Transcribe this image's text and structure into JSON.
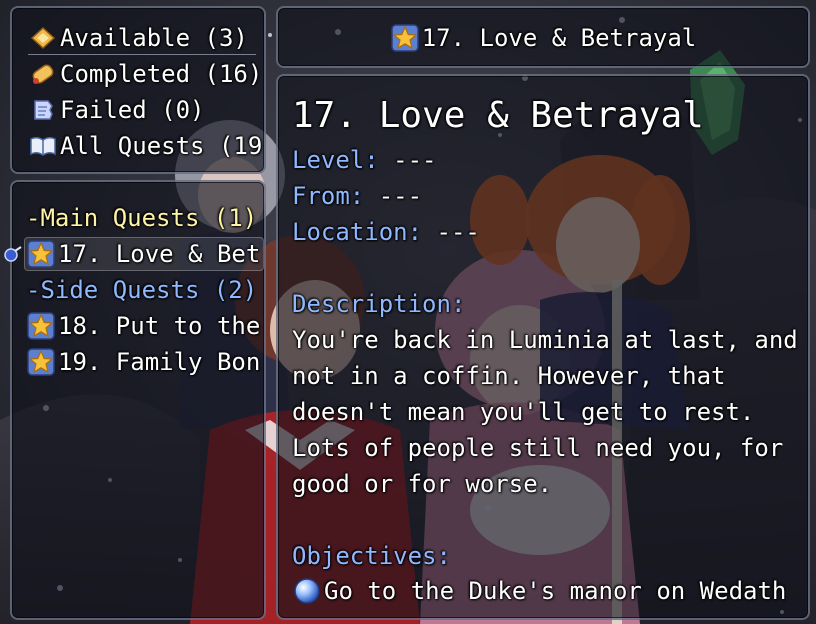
{
  "categories": [
    {
      "label": "Available (3)",
      "icon": "scroll-open-icon"
    },
    {
      "label": "Completed (16)",
      "icon": "scroll-rolled-icon"
    },
    {
      "label": "Failed (0)",
      "icon": "torn-paper-icon"
    },
    {
      "label": "All Quests (19",
      "icon": "open-book-icon"
    }
  ],
  "quest_list": {
    "main_header": "-Main Quests (1)",
    "main_items": [
      {
        "label": "17. Love & Bet",
        "icon": "star-medal-icon",
        "selected": true
      }
    ],
    "side_header": "-Side Quests (2)",
    "side_items": [
      {
        "label": "18. Put to the",
        "icon": "star-medal-icon"
      },
      {
        "label": "19. Family Bon",
        "icon": "star-medal-icon"
      }
    ]
  },
  "title_bar": {
    "text": "17. Love & Betrayal",
    "icon": "star-medal-icon"
  },
  "detail": {
    "title": "17. Love & Betrayal",
    "level_label": "Level:",
    "level_value": " ---",
    "from_label": "From:",
    "from_value": " ---",
    "location_label": "Location:",
    "location_value": " ---",
    "description_label": "Description:",
    "description_lines": [
      "You're back in Luminia at last, and",
      "not in a coffin. However, that",
      "doesn't mean you'll get to rest.",
      "Lots of people still need you, for",
      "good or for worse."
    ],
    "objectives_label": "Objectives:",
    "objectives": [
      {
        "text": "Go to the Duke's manor on Wedath",
        "icon": "blue-orb-icon"
      }
    ]
  },
  "colors": {
    "label_blue": "#8fb8ff",
    "header_yellow": "#fff3a6",
    "text_white": "#ffffff"
  }
}
